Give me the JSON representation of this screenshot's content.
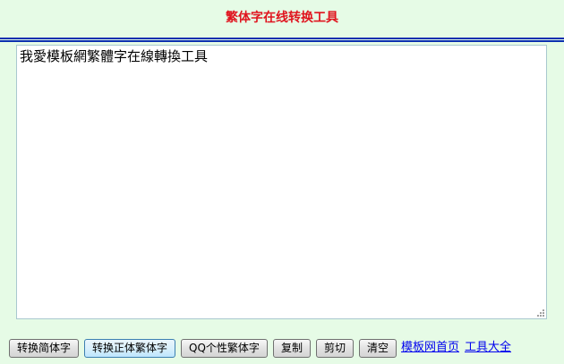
{
  "page": {
    "title": "繁体字在线转换工具",
    "colors": {
      "background": "#e6fbe6",
      "title": "#e0141e",
      "rule": "#0b2fb0",
      "link": "#0000ee"
    }
  },
  "editor": {
    "value": "我愛模板網繁體字在線轉換工具"
  },
  "toolbar": {
    "to_simplified_label": "转换简体字",
    "to_traditional_label": "转换正体繁体字",
    "qq_style_label": "QQ个性繁体字",
    "copy_label": "复制",
    "cut_label": "剪切",
    "clear_label": "清空"
  },
  "links": {
    "home_label": "模板网首页",
    "tools_label": "工具大全"
  }
}
